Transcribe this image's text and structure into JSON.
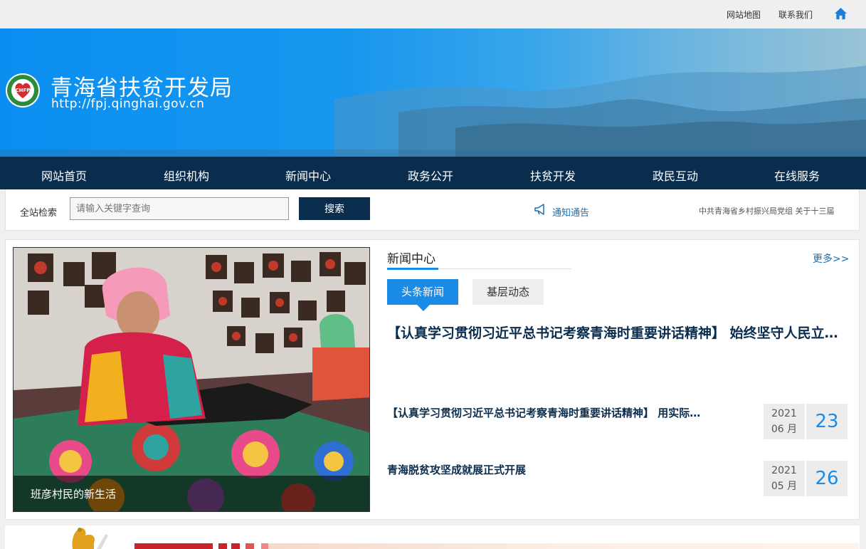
{
  "topbar": {
    "sitemap": "网站地图",
    "contact": "联系我们",
    "home_icon": "home-icon"
  },
  "banner": {
    "site_name": "青海省扶贫开发局",
    "site_url": "http://fpj.qinghai.gov.cn",
    "logo_text": "CHFP"
  },
  "nav": {
    "items": [
      "网站首页",
      "组织机构",
      "新闻中心",
      "政务公开",
      "扶贫开发",
      "政民互动",
      "在线服务"
    ]
  },
  "search": {
    "label": "全站检索",
    "placeholder": "请输入关键字查询",
    "button": "搜索",
    "notice_label": "通知通告",
    "ticker": "中共青海省乡村振兴局党组 关于十三届"
  },
  "feature_photo": {
    "caption": "班彦村民的新生活"
  },
  "news": {
    "title": "新闻中心",
    "more": "更多>>",
    "tabs": [
      "头条新闻",
      "基层动态"
    ],
    "headline": "【认真学习贯彻习近平总书记考察青海时重要讲话精神】 始终坚守人民立场 奋力推进乡村振兴",
    "items": [
      {
        "title": "【认真学习贯彻习近平总书记考察青海时重要讲话精神】 用实际行动践行初心使命",
        "year": "2021",
        "month": "06 月",
        "day": "23"
      },
      {
        "title": "青海脱贫攻坚成就展正式开展",
        "year": "2021",
        "month": "05 月",
        "day": "26"
      }
    ]
  },
  "colors": {
    "nav_bg": "#0a2d4e",
    "accent_blue": "#1a8be6",
    "banner_blue": "#0a8ff1"
  }
}
